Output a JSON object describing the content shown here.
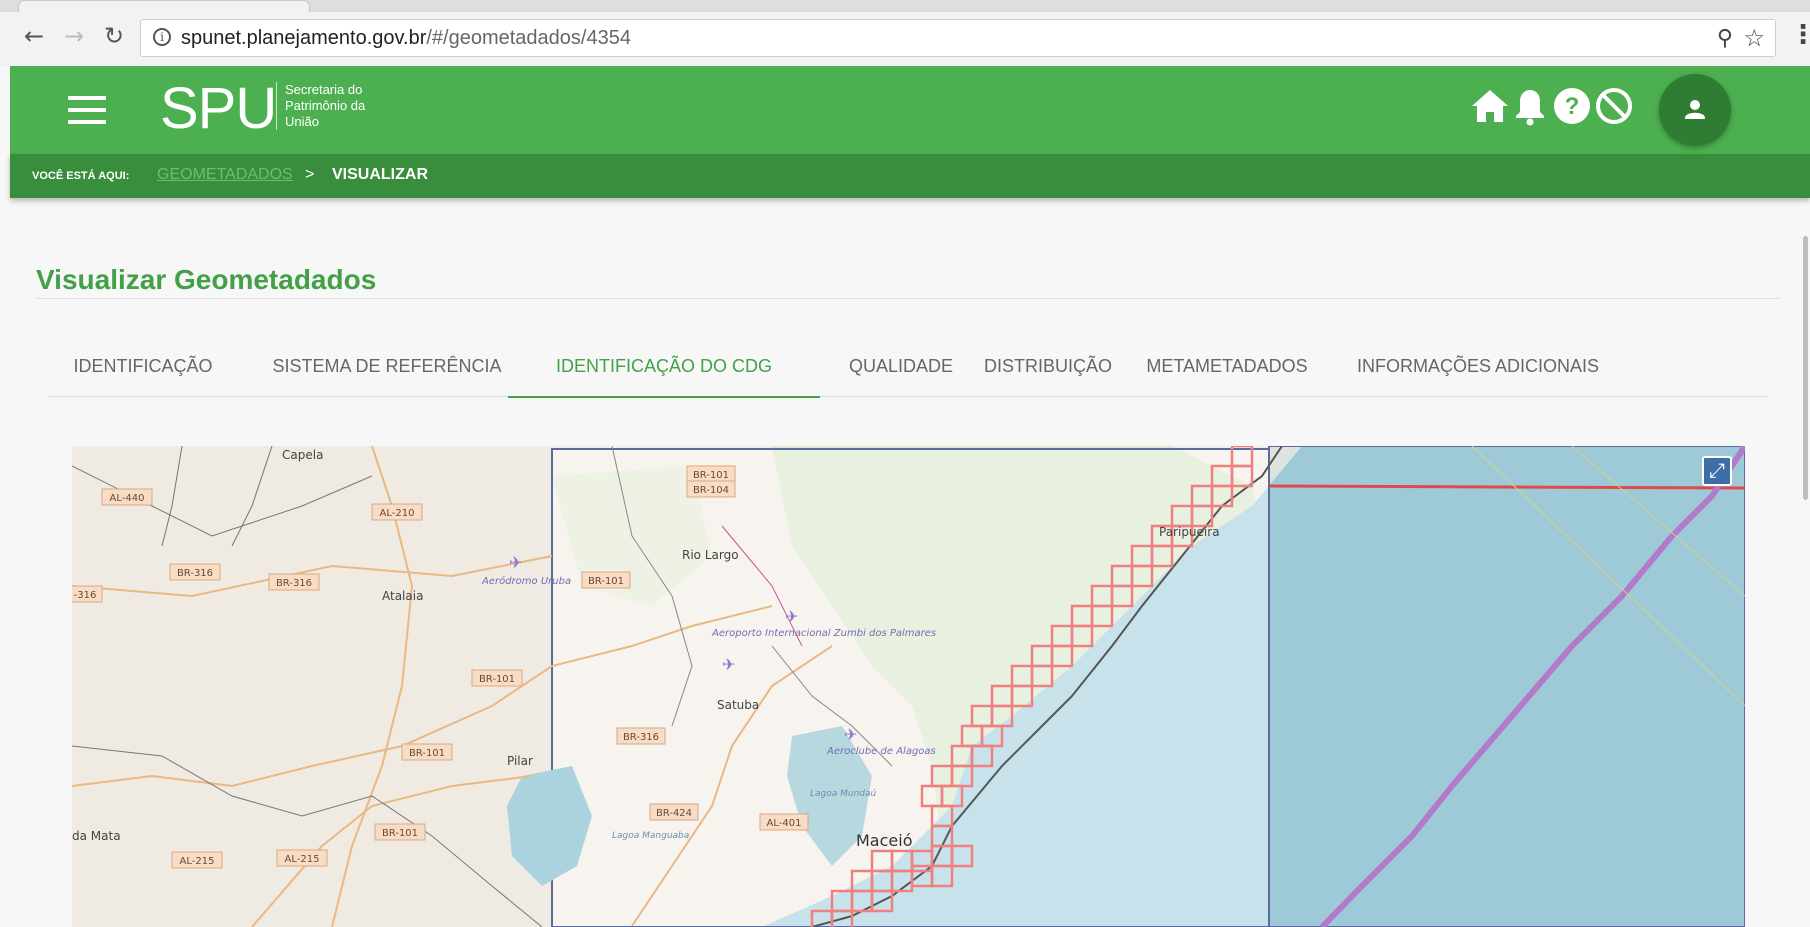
{
  "browser": {
    "url_host": "spunet.planejamento.gov.br",
    "url_path": "/#/geometadados/4354",
    "back_icon": "back-arrow-icon",
    "forward_icon": "forward-arrow-icon",
    "reload_icon": "reload-icon"
  },
  "header": {
    "logo": "SPU",
    "logo_sub": [
      "Secretaria do",
      "Patrimônio da",
      "União"
    ],
    "accent": "#4db050",
    "icons": [
      "home-icon",
      "bell-icon",
      "help-icon",
      "block-icon",
      "user-icon"
    ]
  },
  "breadcrumb": {
    "label": "VOCÊ ESTÁ AQUI:",
    "link": "GEOMETADADOS",
    "separator": ">",
    "current": "VISUALIZAR"
  },
  "page": {
    "title": "Visualizar Geometadados",
    "title_color": "#43a047"
  },
  "tabs": [
    {
      "label": "IDENTIFICAÇÃO",
      "active": false
    },
    {
      "label": "SISTEMA DE REFERÊNCIA",
      "active": false
    },
    {
      "label": "IDENTIFICAÇÃO DO CDG",
      "active": true
    },
    {
      "label": "QUALIDADE",
      "active": false
    },
    {
      "label": "DISTRIBUIÇÃO",
      "active": false
    },
    {
      "label": "METAMETADADOS",
      "active": false
    },
    {
      "label": "INFORMAÇÕES ADICIONAIS",
      "active": false
    }
  ],
  "map": {
    "places": [
      "Capela",
      "Atalaia",
      "Rio Largo",
      "Satuba",
      "Pilar",
      "Maceió",
      "da Mata",
      "Paripueira"
    ],
    "airports": [
      "Aeródromo Uruba",
      "Aeroporto Internacional Zumbi dos Palmares",
      "Aeroclube de Alagoas"
    ],
    "road_shields": [
      "AL-440",
      "AL-210",
      "BR-316",
      "BR-316",
      "BR-101",
      "BR-104",
      "BR-101",
      "BR-101",
      "BR-316",
      "BR-101",
      "BR-101",
      "BR-424",
      "AL-401",
      "AL-215",
      "AL-215"
    ],
    "roads_extra": [
      "-316"
    ],
    "lagoons": [
      "Lagoa Mundaú",
      "Lagoa Manguaba"
    ],
    "fullscreen_icon": "expand-icon"
  }
}
